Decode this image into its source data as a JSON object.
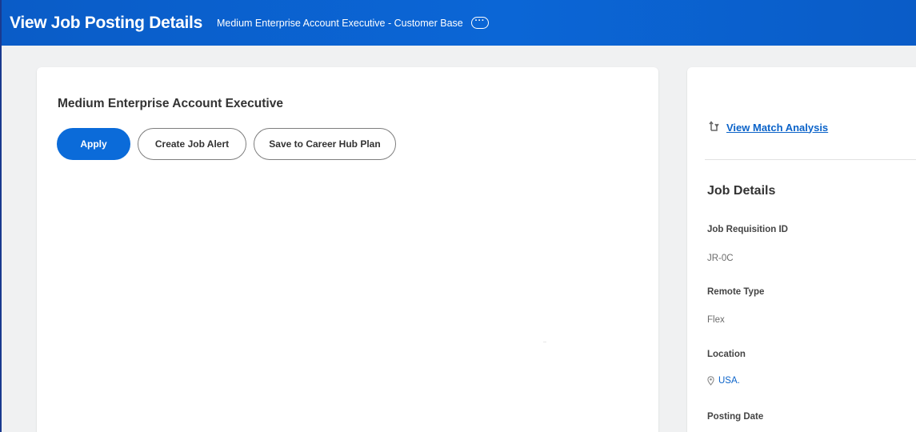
{
  "header": {
    "title": "View Job Posting Details",
    "subtitle": "Medium Enterprise Account Executive - Customer Base",
    "more_icon": "more-horizontal-icon",
    "more_glyph": "···",
    "background_color": "#0b66d6"
  },
  "job": {
    "title": "Medium Enterprise Account Executive",
    "actions": {
      "apply_label": "Apply",
      "create_alert_label": "Create Job Alert",
      "save_label": "Save to Career Hub Plan"
    }
  },
  "sidebar": {
    "match_link": {
      "label": "View Match Analysis",
      "icon": "compare-arrows-icon"
    },
    "details": {
      "title": "Job Details",
      "requisition_label": "Job Requisition ID",
      "requisition_value": "JR-0C",
      "remote_label": "Remote Type",
      "remote_value": "Flex",
      "location_label": "Location",
      "location_value": "USA.",
      "location_icon": "location-pin-icon",
      "posting_date_label": "Posting Date"
    }
  },
  "colors": {
    "accent": "#0b6bd9",
    "link": "#0b63c9",
    "page_background": "#f0f1f2"
  }
}
